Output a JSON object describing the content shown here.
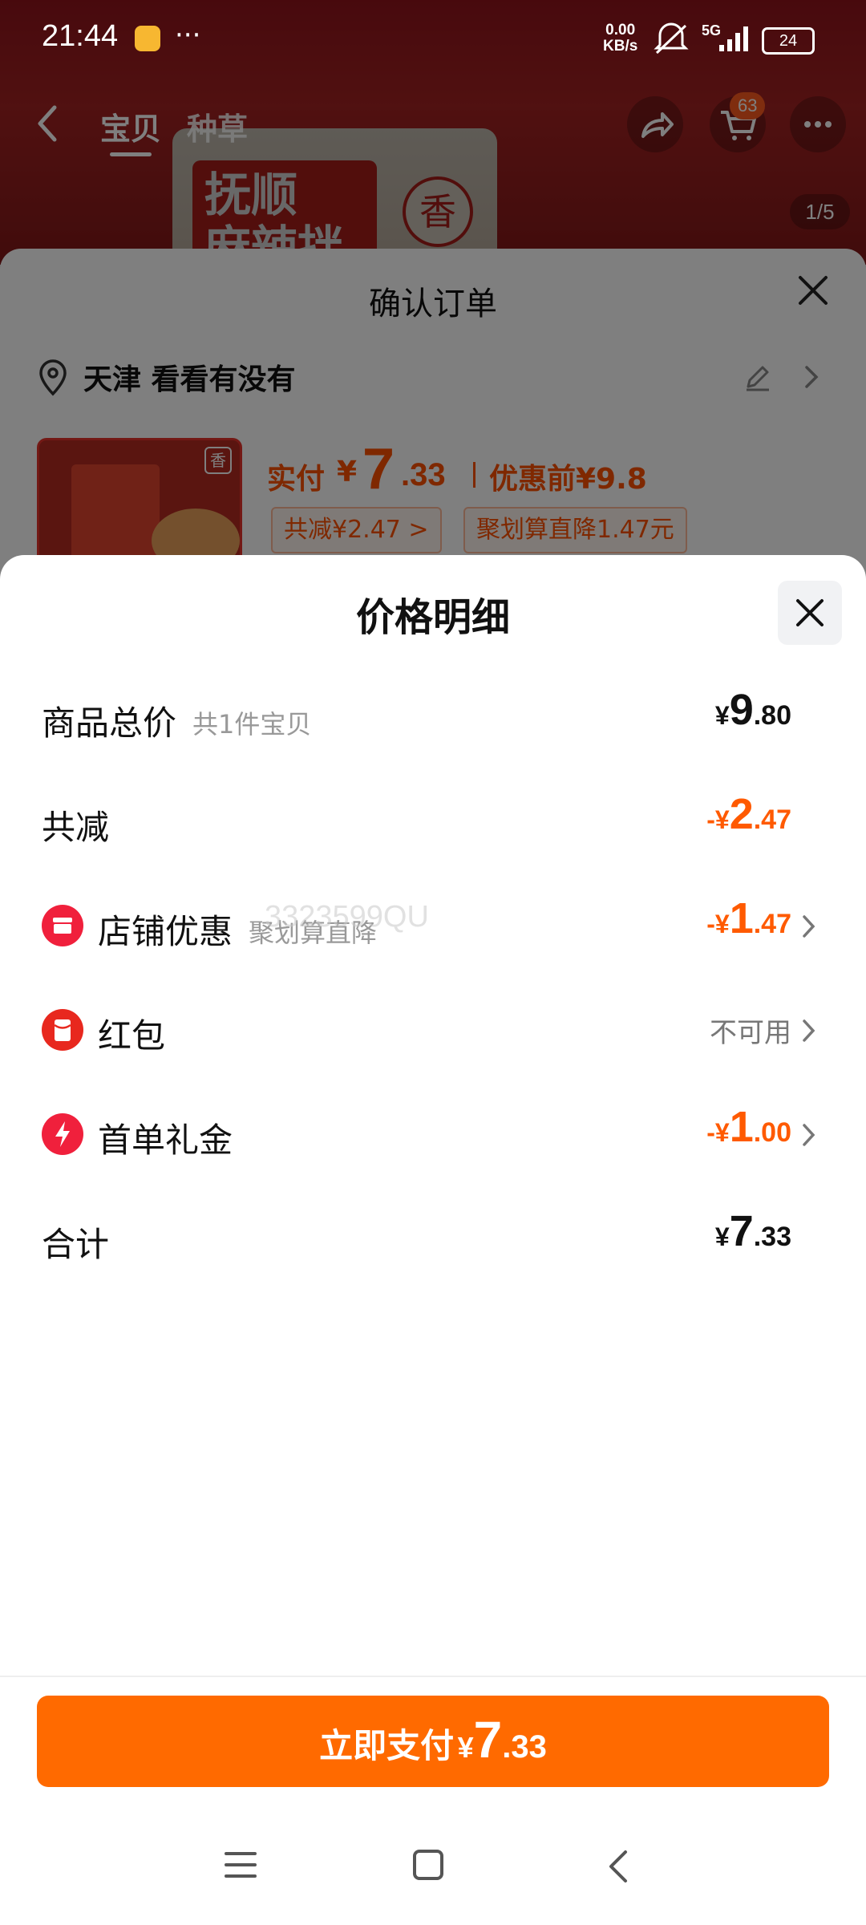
{
  "status_bar": {
    "time": "21:44",
    "net_speed_value": "0.00",
    "net_speed_unit": "KB/s",
    "network": "5G",
    "battery": "24"
  },
  "product_nav": {
    "tab_baobei": "宝贝",
    "tab_zhongcao": "种草",
    "cart_badge": "63",
    "image_counter": "1/5",
    "package_text": "抚顺\n麻辣拌",
    "package_mark": "香"
  },
  "order_sheet": {
    "title": "确认订单",
    "address": "天津 看看有没有",
    "thumb_tag": "香",
    "paid_label": "实付",
    "paid_yen": "¥",
    "paid_int": "7",
    "paid_dec": ".33",
    "before_price": "优惠前¥9.8",
    "chip_total_discount": "共减¥2.47 >",
    "chip_juhuasuan": "聚划算直降1.47元"
  },
  "price_detail": {
    "title": "价格明细",
    "rows": {
      "subtotal": {
        "label": "商品总价",
        "sub": "共1件宝贝",
        "yen": "¥",
        "int": "9",
        "dec": ".80"
      },
      "total_discount": {
        "label": "共减",
        "yen": "-¥",
        "int": "2",
        "dec": ".47"
      },
      "shop_coupon": {
        "label": "店铺优惠",
        "sub": "聚划算直降",
        "yen": "-¥",
        "int": "1",
        "dec": ".47"
      },
      "red_packet": {
        "label": "红包",
        "status": "不可用"
      },
      "first_order": {
        "label": "首单礼金",
        "yen": "-¥",
        "int": "1",
        "dec": ".00"
      },
      "total": {
        "label": "合计",
        "yen": "¥",
        "int": "7",
        "dec": ".33"
      }
    },
    "watermark": "3323599QU"
  },
  "pay_button": {
    "label": "立即支付",
    "yen": "¥",
    "int": "7",
    "dec": ".33"
  },
  "colors": {
    "accent": "#ff6a00",
    "discount": "#ff5a00",
    "shop_icon": "#f0203c",
    "redpacket_icon": "#e8281e",
    "lightning_icon": "#f0203c"
  },
  "icons": [
    "location-pin-icon",
    "edit-icon",
    "chevron-right-icon",
    "close-icon",
    "shop-icon",
    "red-packet-icon",
    "lightning-icon",
    "menu-icon",
    "home-icon",
    "back-icon",
    "share-icon",
    "cart-icon"
  ]
}
